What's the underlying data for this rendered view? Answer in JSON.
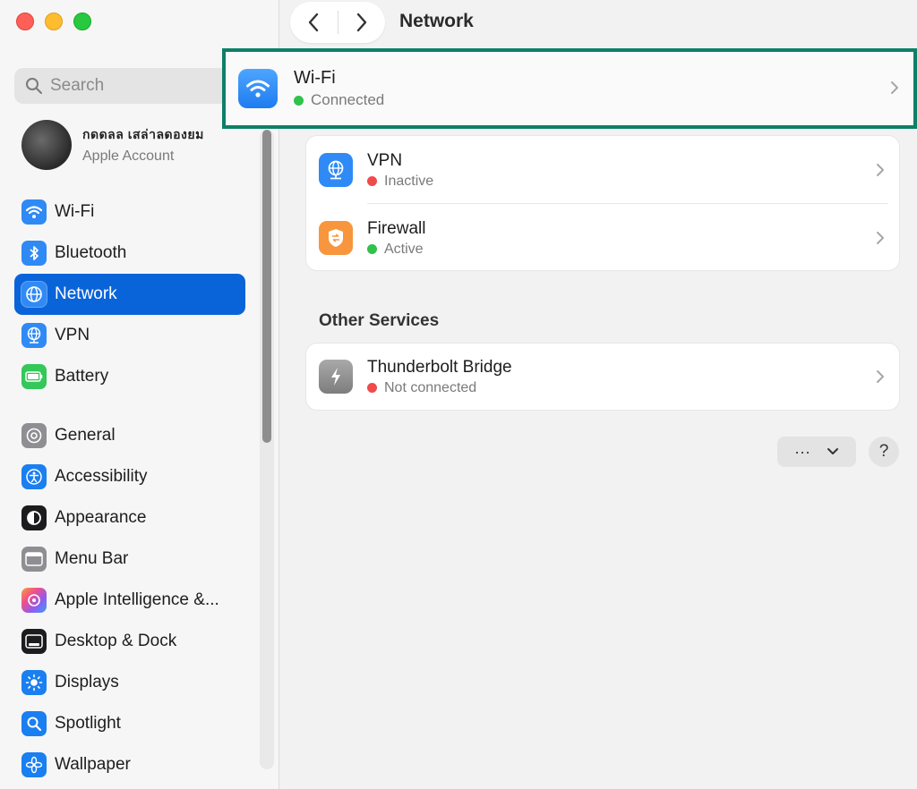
{
  "window": {
    "title": "Network"
  },
  "sidebar": {
    "search_placeholder": "Search",
    "account": {
      "name": "กดดลล เสล่าลดองยม",
      "subtitle": "Apple Account"
    },
    "groups": [
      {
        "items": [
          {
            "label": "Wi-Fi",
            "icon": "wifi-icon",
            "color": "#2f8af5",
            "active": false
          },
          {
            "label": "Bluetooth",
            "icon": "bluetooth-icon",
            "color": "#2f8af5",
            "active": false
          },
          {
            "label": "Network",
            "icon": "globe-icon",
            "color": "#2f8af5",
            "active": true
          },
          {
            "label": "VPN",
            "icon": "vpn-globe-icon",
            "color": "#2f8af5",
            "active": false
          },
          {
            "label": "Battery",
            "icon": "battery-icon",
            "color": "#34c759",
            "active": false
          }
        ]
      },
      {
        "items": [
          {
            "label": "General",
            "icon": "gear-icon",
            "color": "#8e8e93",
            "active": false
          },
          {
            "label": "Accessibility",
            "icon": "accessibility-icon",
            "color": "#1a7ff0",
            "active": false
          },
          {
            "label": "Appearance",
            "icon": "appearance-icon",
            "color": "#1c1c1e",
            "active": false
          },
          {
            "label": "Menu Bar",
            "icon": "menubar-icon",
            "color": "#8e8e93",
            "active": false
          },
          {
            "label": "Apple Intelligence &...",
            "icon": "apple-intelligence-icon",
            "color": "#f06a8a",
            "active": false
          },
          {
            "label": "Desktop & Dock",
            "icon": "dock-icon",
            "color": "#1c1c1e",
            "active": false
          },
          {
            "label": "Displays",
            "icon": "sun-icon",
            "color": "#1a7ff0",
            "active": false
          },
          {
            "label": "Spotlight",
            "icon": "magnifier-icon",
            "color": "#1a7ff0",
            "active": false
          },
          {
            "label": "Wallpaper",
            "icon": "flower-icon",
            "color": "#1a7ff0",
            "active": false
          }
        ]
      }
    ]
  },
  "main": {
    "wifi": {
      "title": "Wi-Fi",
      "status": "Connected",
      "status_color": "#30c24a"
    },
    "services": [
      {
        "title": "VPN",
        "status": "Inactive",
        "status_color": "#f04a4a",
        "icon": "vpn-globe-icon"
      },
      {
        "title": "Firewall",
        "status": "Active",
        "status_color": "#30c24a",
        "icon": "firewall-shield-icon"
      }
    ],
    "other_services_label": "Other Services",
    "other_services": [
      {
        "title": "Thunderbolt Bridge",
        "status": "Not connected",
        "status_color": "#f04a4a",
        "icon": "thunderbolt-icon"
      }
    ],
    "more_button_label": "···",
    "help_button_label": "?"
  },
  "colors": {
    "accent": "#0a64d9",
    "highlight_border": "#0d8068"
  }
}
